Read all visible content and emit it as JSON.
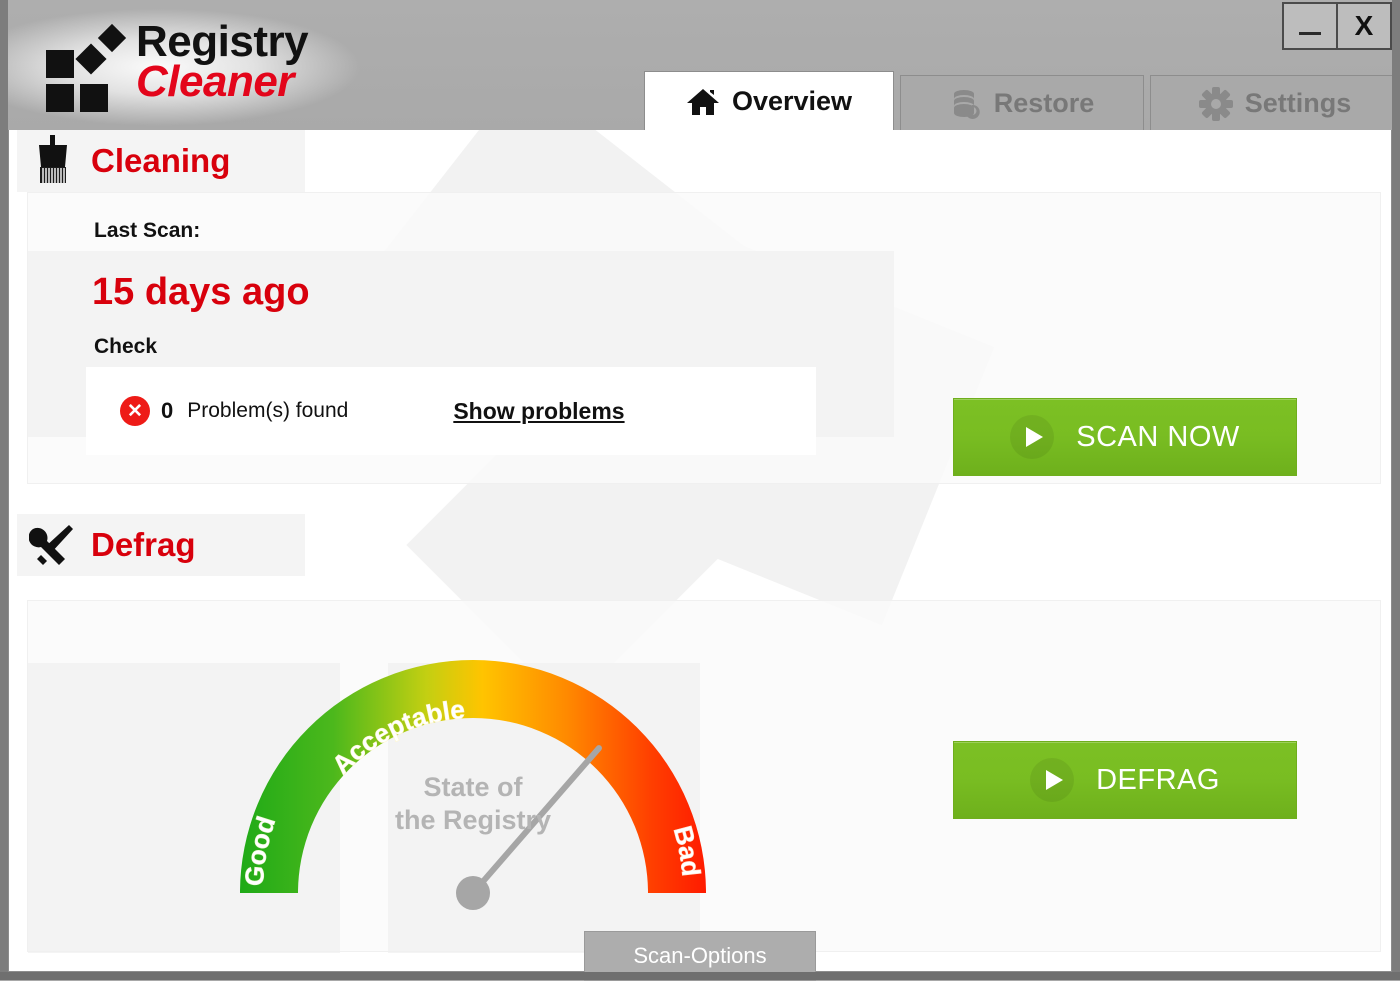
{
  "app": {
    "logo_line1": "Registry",
    "logo_line2": "Cleaner"
  },
  "window_controls": {
    "minimize_label": "",
    "close_label": "X"
  },
  "tabs": [
    {
      "label": "Overview",
      "icon": "home-icon",
      "active": true
    },
    {
      "label": "Restore",
      "icon": "database-restore-icon",
      "active": false
    },
    {
      "label": "Settings",
      "icon": "gear-icon",
      "active": false
    }
  ],
  "cleaning": {
    "title": "Cleaning",
    "icon": "brush-icon",
    "last_scan_label": "Last Scan:",
    "last_scan_value": "15 days ago",
    "check_label": "Check",
    "problem_icon": "error-x-icon",
    "problem_count": "0",
    "problem_text": "Problem(s) found",
    "show_problems_label": "Show problems",
    "scan_button_label": "SCAN NOW"
  },
  "defrag": {
    "title": "Defrag",
    "icon": "tools-icon",
    "defrag_button_label": "DEFRAG",
    "gauge": {
      "center_label_line1": "State of",
      "center_label_line2": "the Registry",
      "zone_good": "Good",
      "zone_acceptable": "Acceptable",
      "zone_bad": "Bad",
      "needle_angle_deg": 49,
      "needle_value_percent": 78
    }
  },
  "footer": {
    "scan_options_label": "Scan-Options"
  },
  "colors": {
    "brand_red": "#d8000c",
    "accent_green": "#79bd22",
    "chrome_gray": "#a9a9a9",
    "gauge_good": "#2aa81f",
    "gauge_acceptable": "#ffc000",
    "gauge_bad": "#ff2200",
    "error_red": "#ee1b17"
  }
}
